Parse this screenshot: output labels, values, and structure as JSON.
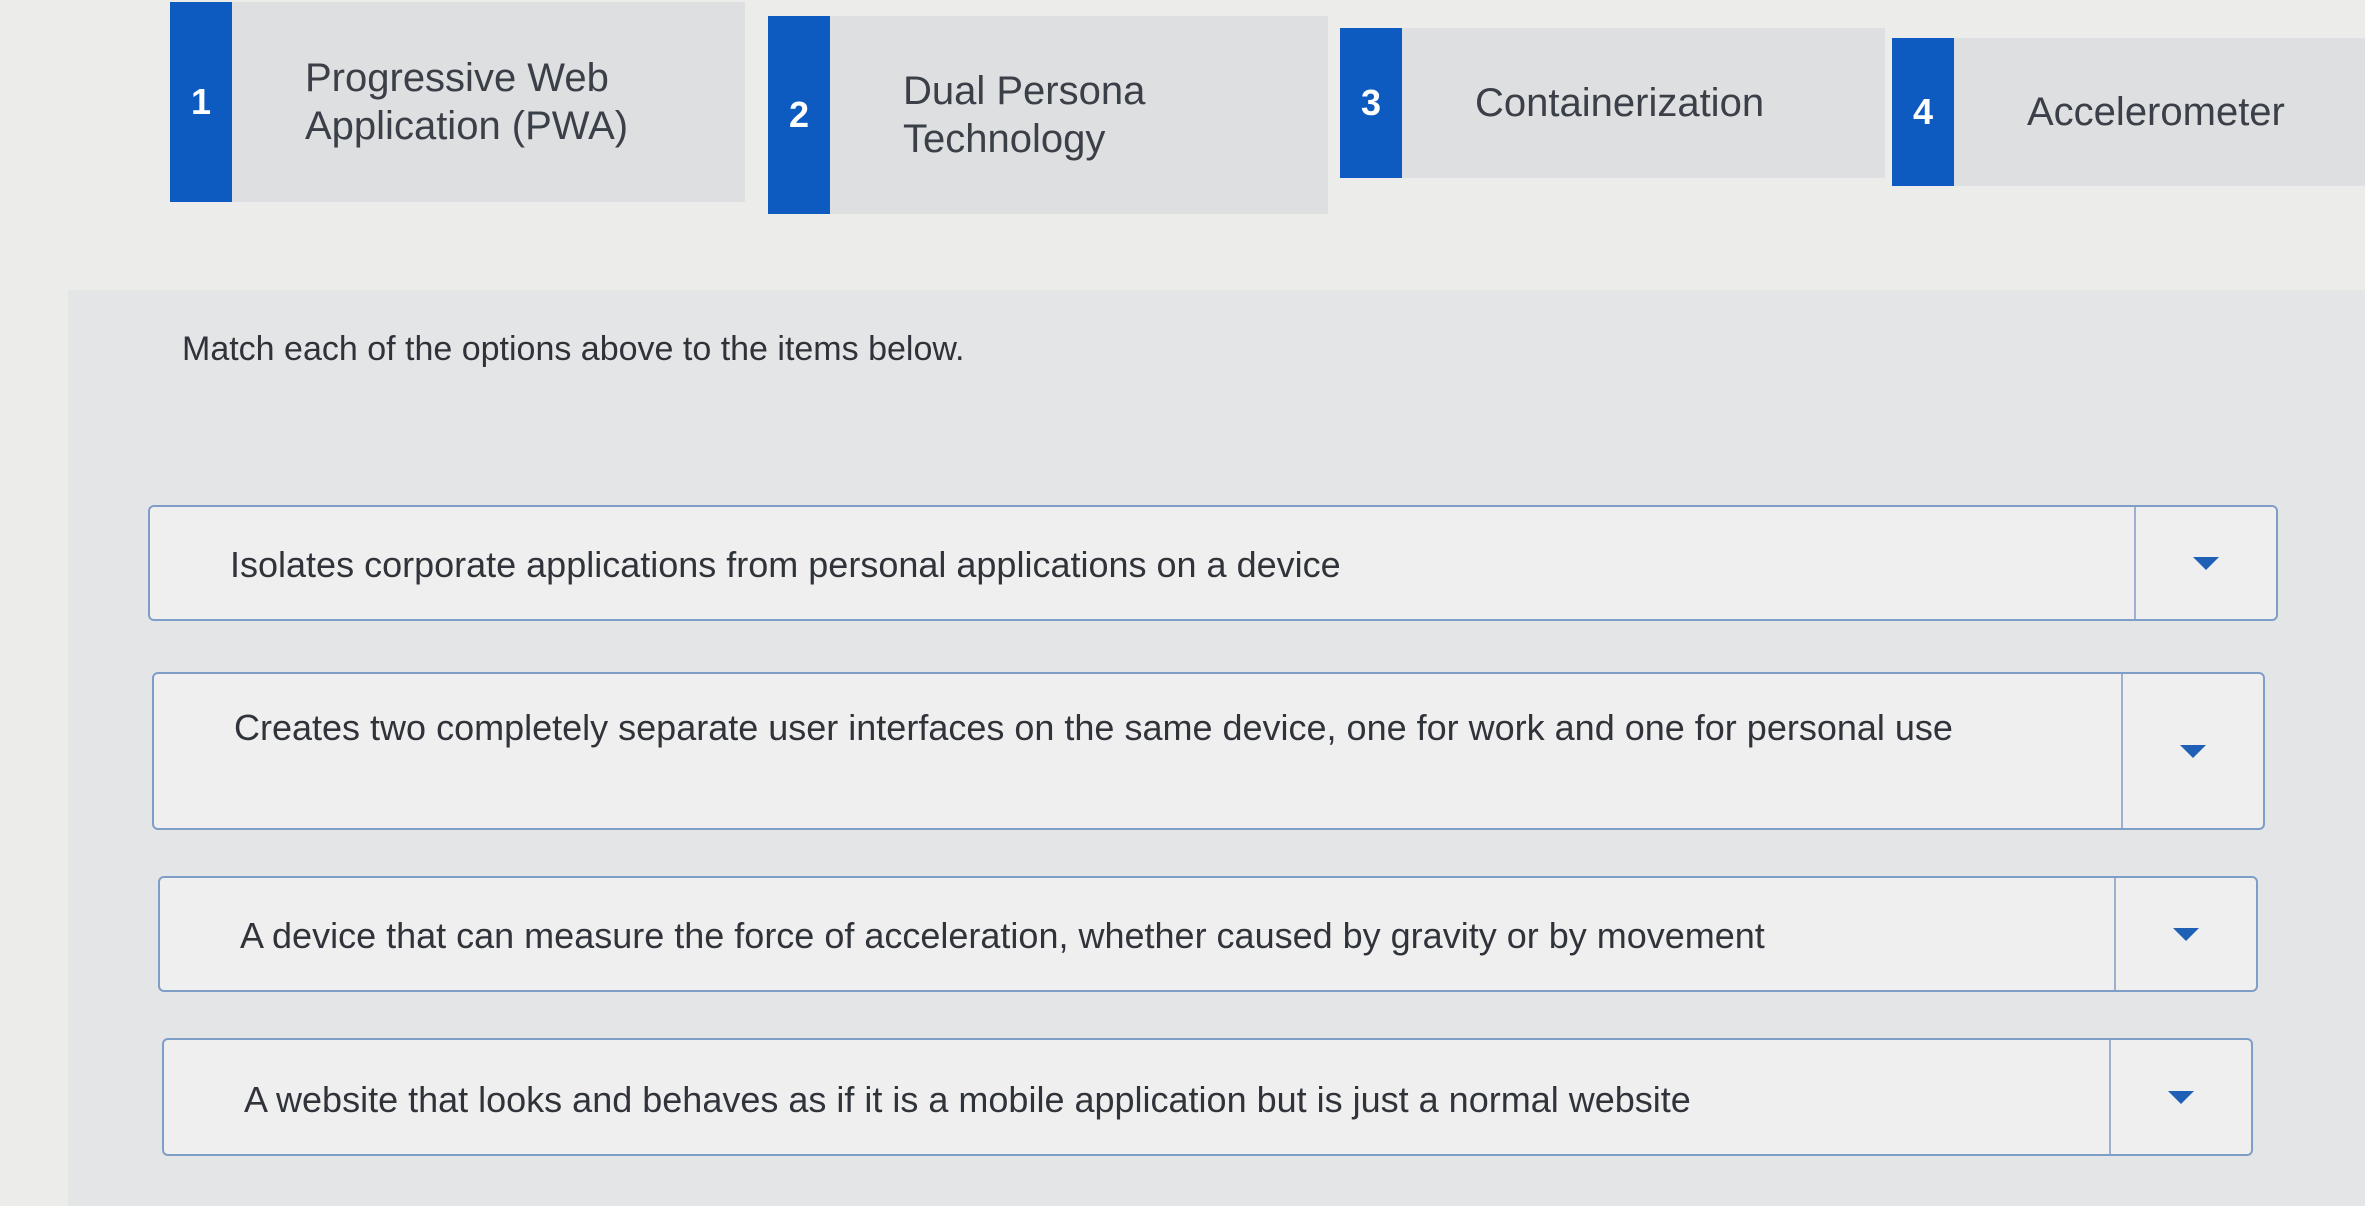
{
  "options": [
    {
      "number": "1",
      "label": "Progressive Web\nApplication (PWA)"
    },
    {
      "number": "2",
      "label": "Dual Persona\nTechnology"
    },
    {
      "number": "3",
      "label": "Containerization"
    },
    {
      "number": "4",
      "label": "Accelerometer"
    }
  ],
  "instruction": "Match each of the options above to the items below.",
  "items": [
    {
      "text": "Isolates corporate applications from personal applications on a device"
    },
    {
      "text": "Creates two completely separate user interfaces on the same device, one for work and one for personal use"
    },
    {
      "text": "A device that can measure the force of acceleration, whether caused by gravity or by movement"
    },
    {
      "text": "A website that looks and behaves as if it is a mobile application but is just a normal website"
    }
  ],
  "dropdown_icon": "caret-down-icon",
  "colors": {
    "accent": "#0d5bc0",
    "border": "#7f9ec7",
    "option_bg": "#dedfe1",
    "page_bg": "#ececea"
  }
}
